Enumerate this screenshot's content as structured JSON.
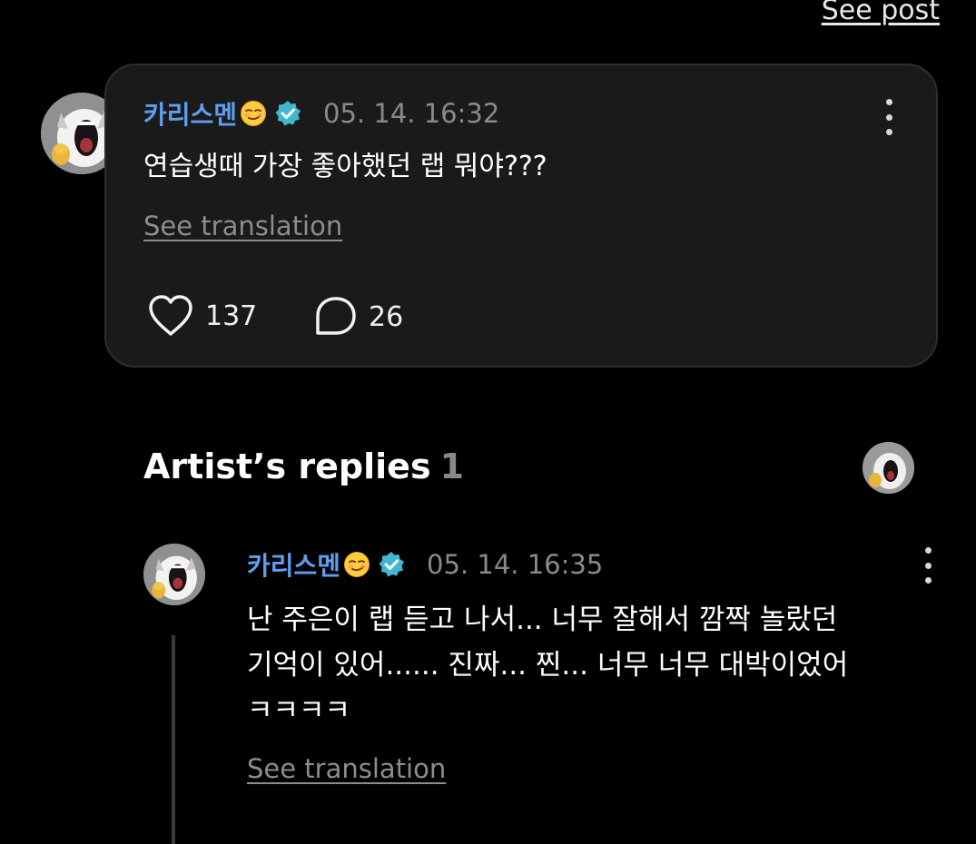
{
  "header": {
    "see_post_label": "See post"
  },
  "post": {
    "author": "카리스멘",
    "avatar_icon": "screaming-cat-avatar",
    "emoji_icon": "smirking-face-emoji",
    "verified_icon": "verified-badge-icon",
    "timestamp": "05. 14. 16:32",
    "text": "연습생때 가장 좋아했던 랩 뭐야???",
    "translation_label": "See translation",
    "likes": "137",
    "comments": "26"
  },
  "artist_replies": {
    "title": "Artist’s replies",
    "count": "1",
    "artist_avatar_icon": "artist-avatar"
  },
  "reply": {
    "author": "카리스멘",
    "avatar_icon": "screaming-cat-avatar",
    "emoji_icon": "smirking-face-emoji",
    "verified_icon": "verified-badge-icon",
    "timestamp": "05. 14. 16:35",
    "lines": [
      "난 주은이 랩 듣고 나서... 너무 잘해서 깜짝 놀랐던",
      "기억이 있어...... 진짜... 찐... 너무 너무 대박이었어",
      "ㅋㅋㅋㅋ"
    ],
    "translation_label": "See translation"
  },
  "colors": {
    "background": "#000000",
    "card": "#1a1a1a",
    "author_name": "#5e9ff2",
    "verified_badge": "#3fb8d0",
    "muted_text": "#8a8a8a"
  }
}
